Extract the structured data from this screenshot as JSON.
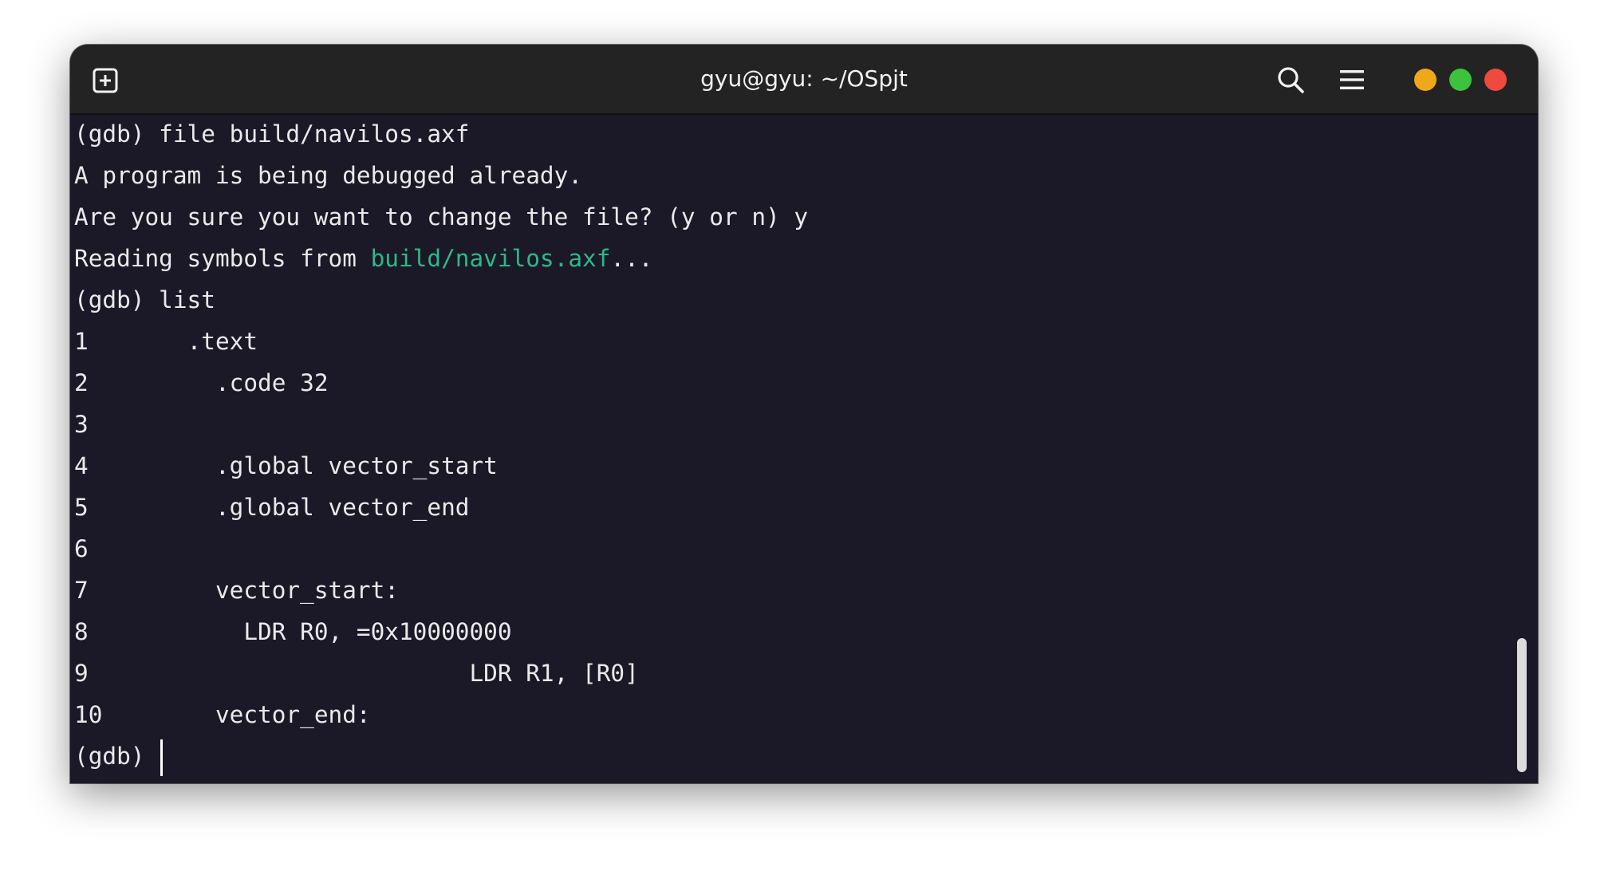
{
  "window": {
    "title": "gyu@gyu: ~/OSpjt",
    "icons": {
      "new_tab": "new-tab-plus-icon",
      "search": "search-icon",
      "menu": "hamburger-menu-icon"
    },
    "controls": {
      "minimize_color": "#f0a81b",
      "maximize_color": "#3cc23c",
      "close_color": "#ee4a3f"
    }
  },
  "terminal": {
    "background": "#1b1928",
    "link_color": "#2eb887",
    "lines": [
      {
        "text": "(gdb) file build/navilos.axf"
      },
      {
        "text": "A program is being debugged already."
      },
      {
        "text": "Are you sure you want to change the file? (y or n) y"
      },
      {
        "prefix": "Reading symbols from ",
        "path": "build/navilos.axf",
        "suffix": "..."
      },
      {
        "text": "(gdb) list"
      },
      {
        "text": "1\t.text"
      },
      {
        "text": "2\t  .code 32"
      },
      {
        "text": "3"
      },
      {
        "text": "4\t  .global vector_start"
      },
      {
        "text": "5\t  .global vector_end"
      },
      {
        "text": "6"
      },
      {
        "text": "7\t  vector_start:"
      },
      {
        "text": "8\t    LDR R0, =0x10000000"
      },
      {
        "text": "9\t\t\t    LDR R1, [R0]"
      },
      {
        "text": "10\t  vector_end:"
      }
    ],
    "prompt": "(gdb) "
  }
}
